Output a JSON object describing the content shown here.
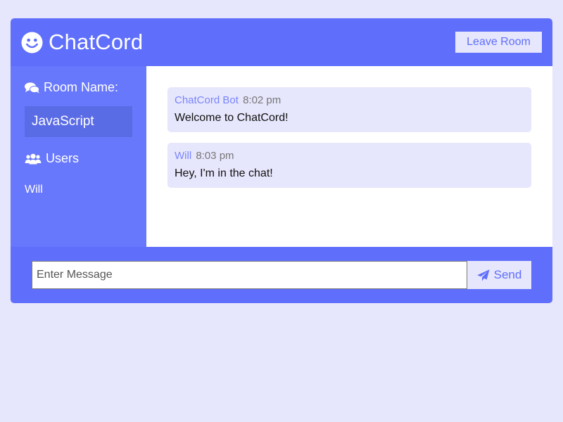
{
  "header": {
    "logo_icon": "smiley-icon",
    "title": "ChatCord",
    "leave_label": "Leave Room"
  },
  "sidebar": {
    "room_heading": "Room Name:",
    "room_icon": "comments-icon",
    "room_name": "JavaScript",
    "users_heading": "Users",
    "users_icon": "users-icon",
    "users": [
      "Will"
    ]
  },
  "messages": [
    {
      "user": "ChatCord Bot",
      "time": "8:02 pm",
      "text": "Welcome to ChatCord!"
    },
    {
      "user": "Will",
      "time": "8:03 pm",
      "text": "Hey, I'm in the chat!"
    }
  ],
  "form": {
    "placeholder": "Enter Message",
    "value": "",
    "send_icon": "paper-plane-icon",
    "send_label": "Send"
  },
  "colors": {
    "background": "#e6e6fc",
    "primary": "#5f6ffc",
    "sidebar": "#6878fc",
    "room_box": "#5a6be6",
    "username": "#7a86fb"
  }
}
